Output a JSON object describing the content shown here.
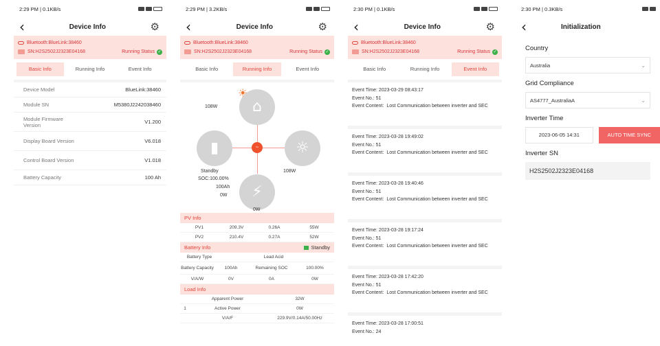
{
  "screens": {
    "basic": {
      "status_time": "2:29 PM | 0.1KB/s",
      "status_right": "(38)",
      "title": "Device Info",
      "bluetooth": "Bluetooth:BlueLink:38460",
      "sn": "SN:H2S2502J2323E04168",
      "running_status": "Running Status",
      "tabs": [
        "Basic Info",
        "Running Info",
        "Event Info"
      ],
      "rows": [
        {
          "label": "Device Model",
          "value": "BlueLink:38460"
        },
        {
          "label": "Module SN",
          "value": "M5380J2242038460"
        },
        {
          "label": "Module Firmware Version",
          "value": "V1.200"
        },
        {
          "label": "Display Board Version",
          "value": "V6.018"
        },
        {
          "label": "Control Board Version",
          "value": "V1.018"
        },
        {
          "label": "Battery Capacity",
          "value": "100 Ah"
        }
      ]
    },
    "running": {
      "status_time": "2:29 PM | 3.2KB/s",
      "status_right": "(38)",
      "title": "Device Info",
      "bluetooth": "Bluetooth:BlueLink:38460",
      "sn": "SN:H2S2502J2323E04168",
      "running_status": "Running Status",
      "tabs": [
        "Basic Info",
        "Running Info",
        "Event Info"
      ],
      "diagram": {
        "pv_power": "108W",
        "load_power": "108W",
        "battery_state": "Standby",
        "battery_soc": "SOC:100.00%",
        "battery_capacity": "100Ah",
        "battery_power": "0W",
        "grid_power": "0W"
      },
      "pv_info": {
        "title": "PV Info",
        "rows": [
          [
            "PV1",
            "209.3V",
            "0.26A",
            "55W"
          ],
          [
            "PV2",
            "210.4V",
            "0.27A",
            "52W"
          ]
        ]
      },
      "battery_info": {
        "title": "Battery Info",
        "status": "Standby",
        "rows": [
          [
            "Battery Type",
            "",
            "Lead Acid",
            ""
          ],
          [
            "Battery Capacity",
            "100Ah",
            "Remaining SOC",
            "100.00%"
          ],
          [
            "V/A/W",
            "0V",
            "0A",
            "0W"
          ]
        ]
      },
      "load_info": {
        "title": "Load Info",
        "rows": [
          [
            "",
            "Apparent Power",
            "32W"
          ],
          [
            "1",
            "Active Power",
            "0W"
          ],
          [
            "",
            "V/A/F",
            "229.9V/0.14A/50.00Hz"
          ]
        ]
      }
    },
    "events": {
      "status_time": "2:30 PM | 0.1KB/s",
      "status_right": "(38)",
      "title": "Device Info",
      "bluetooth": "Bluetooth:BlueLink:38460",
      "sn": "SN:H2S2502J2323E04168",
      "running_status": "Running Status",
      "tabs": [
        "Basic Info",
        "Running Info",
        "Event Info"
      ],
      "time_label": "Event Time:",
      "no_label": "Event No.:",
      "content_label": "Event Content:",
      "items": [
        {
          "time": "2023-03-29 08:43:17",
          "no": "51",
          "content": "Lost Communication between inverter and SEC"
        },
        {
          "time": "2023-03-28 19:49:02",
          "no": "51",
          "content": "Lost Communication between inverter and SEC"
        },
        {
          "time": "2023-03-28 19:40:46",
          "no": "51",
          "content": "Lost Communication between inverter and SEC"
        },
        {
          "time": "2023-03-28 19:17:24",
          "no": "51",
          "content": "Lost Communication between inverter and SEC"
        },
        {
          "time": "2023-03-28 17:42:20",
          "no": "51",
          "content": "Lost Communication between inverter and SEC"
        },
        {
          "time": "2023-03-28 17:00:51",
          "no": "24",
          "content": ""
        }
      ]
    },
    "init": {
      "status_time": "2:30 PM | 0.3KB/s",
      "title": "Initialization",
      "country_label": "Country",
      "country_value": "Australia",
      "grid_label": "Grid Compliance",
      "grid_value": "AS4777_AustraliaA",
      "time_label": "Inverter Time",
      "time_value": "2023-06-05 14:31",
      "sync_label": "AUTO TIME SYNC",
      "sn_label": "Inverter SN",
      "sn_value": "H2S2502J2323E04168"
    }
  },
  "colors": {
    "accent": "#e0443c",
    "accent_bg": "#fde1dc",
    "status_ok": "#3cb14a",
    "sync_button": "#f26565"
  },
  "icons": [
    "back-arrow-icon",
    "gear-icon",
    "bluetooth-icon",
    "sn-card-icon",
    "check-circle-icon",
    "sun-icon",
    "house-icon",
    "battery-icon",
    "bulb-icon",
    "grid-tower-icon",
    "chevron-down-icon"
  ]
}
